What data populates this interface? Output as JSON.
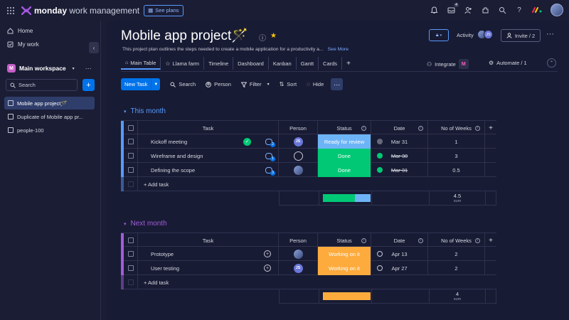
{
  "topbar": {
    "brand_bold": "monday",
    "brand_light": "work management",
    "see_plans": "See plans",
    "inbox_badge": "4"
  },
  "sidebar": {
    "home": "Home",
    "my_work": "My work",
    "workspace_initial": "M",
    "workspace_name": "Main workspace",
    "search_placeholder": "Search",
    "boards": [
      {
        "label": "Mobile app project🪄"
      },
      {
        "label": "Duplicate of Mobile app pr..."
      },
      {
        "label": "people-100"
      }
    ]
  },
  "board": {
    "title": "Mobile app project🪄",
    "description": "This project plan outlines the steps needed to create a mobile application for a productivity a...",
    "see_more": "See More",
    "activity": "Activity",
    "activity_avatar": "JS",
    "invite": "Invite / 2"
  },
  "tabs": [
    {
      "label": "Main Table"
    },
    {
      "label": "Llama farm"
    },
    {
      "label": "Timeline"
    },
    {
      "label": "Dashboard"
    },
    {
      "label": "Kanban"
    },
    {
      "label": "Gantt"
    },
    {
      "label": "Cards"
    }
  ],
  "integrate": "Integrate",
  "automate": "Automate / 1",
  "toolbar": {
    "new_task": "New Task",
    "search": "Search",
    "person": "Person",
    "filter": "Filter",
    "sort": "Sort",
    "hide": "Hide"
  },
  "columns": {
    "task": "Task",
    "person": "Person",
    "status": "Status",
    "date": "Date",
    "weeks": "No of Weeks"
  },
  "colors": {
    "this_month": "#579bfc",
    "next_month": "#a25ddc",
    "ready_for_review": "#6db4f7",
    "done": "#00c875",
    "working_on_it": "#fdab3d"
  },
  "groups": [
    {
      "name": "This month",
      "add_task": "+ Add task",
      "rows": [
        {
          "task": "Kickoff meeting",
          "person": "JS",
          "status": "Ready for review",
          "date": "Mar 31",
          "weeks": "1"
        },
        {
          "task": "Wireframe and design",
          "person": "",
          "status": "Done",
          "date": "Mar 30",
          "weeks": "3"
        },
        {
          "task": "Defining the scope",
          "person": "",
          "status": "Done",
          "date": "Mar 31",
          "weeks": "0.5"
        }
      ],
      "sum": "4.5",
      "sum_label": "sum"
    },
    {
      "name": "Next month",
      "add_task": "+ Add task",
      "rows": [
        {
          "task": "Prototype",
          "person": "",
          "status": "Working on it",
          "date": "Apr 13",
          "weeks": "2"
        },
        {
          "task": "User testing",
          "person": "JS",
          "status": "Working on it",
          "date": "Apr 27",
          "weeks": "2"
        }
      ],
      "sum": "4",
      "sum_label": "sum"
    }
  ]
}
